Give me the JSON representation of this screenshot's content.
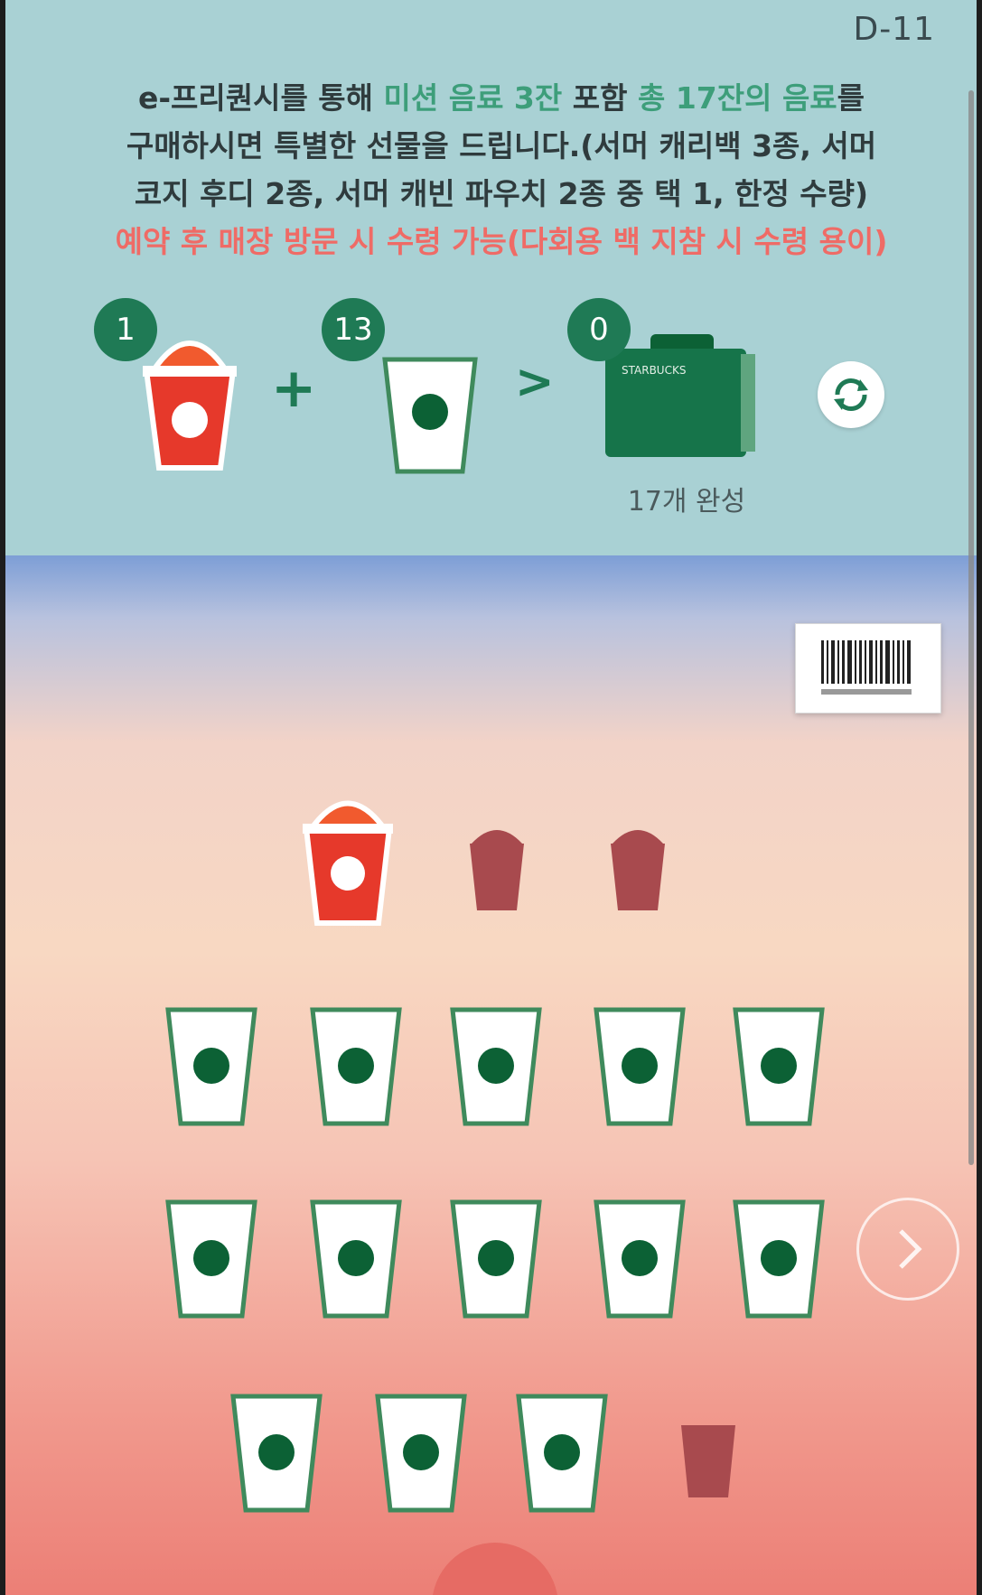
{
  "dday": "D-11",
  "description": {
    "line1_pre": "e-프리퀀시를 통해 ",
    "line1_green1": "미션 음료 3잔",
    "line1_mid": " 포함 ",
    "line1_green2": "총 17잔의 음료",
    "line1_post": "를",
    "line2": "구매하시면 특별한 선물을 드립니다.(서머 캐리백 3종, 서머",
    "line3": "코지 후디 2종, 서머 캐빈 파우치 2종 중 택 1, 한정 수량)",
    "line4_red": "예약 후 매장 방문 시 수령 가능(다회용 백 지참 시 수령 용이)"
  },
  "summary": {
    "mission_count": "1",
    "regular_count": "13",
    "gift_count": "0",
    "plus": "+",
    "arrow": ">",
    "gift_brand": "STARBUCKS",
    "complete_label": "17개 완성"
  },
  "stamps": {
    "mission": [
      "filled",
      "empty",
      "empty"
    ],
    "regular": [
      "filled",
      "filled",
      "filled",
      "filled",
      "filled",
      "filled",
      "filled",
      "filled",
      "filled",
      "filled",
      "filled",
      "filled",
      "filled",
      "empty"
    ]
  },
  "colors": {
    "top_bg": "#a9d1d4",
    "badge_green": "#1f7a55",
    "starbucks_green": "#0c6135",
    "mission_red": "#e6392b",
    "empty_cup": "#a84a4e",
    "text_green": "#3d9e7a",
    "text_red": "#ef6b66"
  },
  "icons": {
    "refresh": "refresh-icon",
    "barcode": "barcode-icon",
    "next": "chevron-right-icon"
  }
}
